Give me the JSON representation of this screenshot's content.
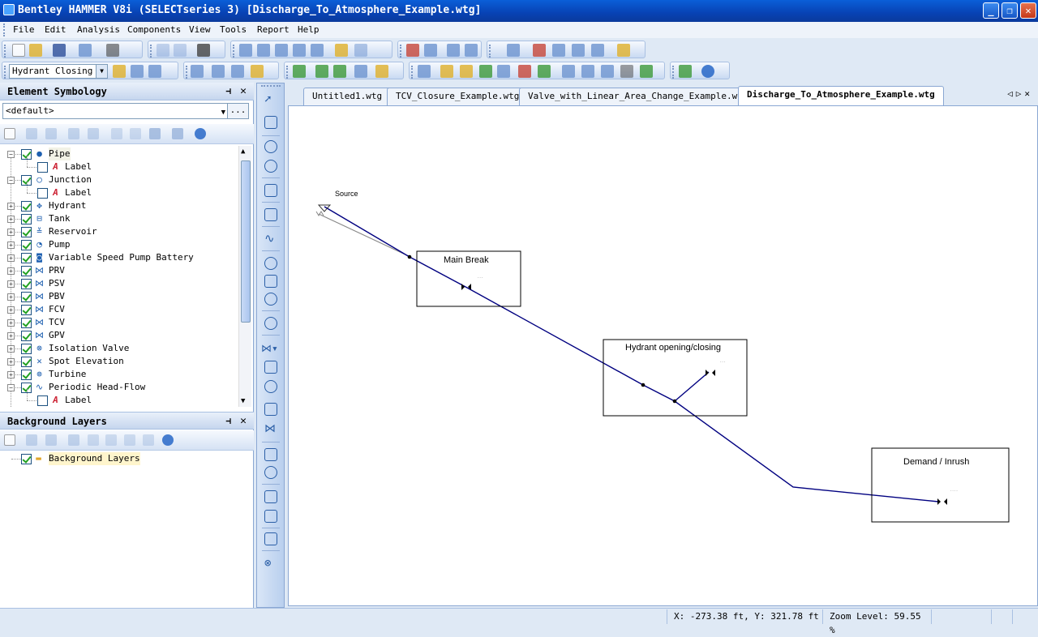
{
  "window": {
    "title": "Bentley HAMMER V8i (SELECTseries 3) [Discharge_To_Atmosphere_Example.wtg]"
  },
  "menu": [
    "File",
    "Edit",
    "Analysis",
    "Components",
    "View",
    "Tools",
    "Report",
    "Help"
  ],
  "toolbar": {
    "scenario_selected": "Hydrant Closing"
  },
  "element_symbology": {
    "title": "Element Symbology",
    "dropdown_value": "<default>",
    "ellipsis": "...",
    "items": [
      {
        "label": "Pipe",
        "checked": true,
        "icon": "pipe-icon",
        "glyph": "●",
        "expanded": true
      },
      {
        "label": "Label",
        "checked": false,
        "icon": "label-icon",
        "glyph": "A",
        "child": true
      },
      {
        "label": "Junction",
        "checked": true,
        "icon": "junction-icon",
        "glyph": "○",
        "expanded": true
      },
      {
        "label": "Label",
        "checked": false,
        "icon": "label-icon",
        "glyph": "A",
        "child": true
      },
      {
        "label": "Hydrant",
        "checked": true,
        "icon": "hydrant-icon",
        "glyph": "✥"
      },
      {
        "label": "Tank",
        "checked": true,
        "icon": "tank-icon",
        "glyph": "⊟"
      },
      {
        "label": "Reservoir",
        "checked": true,
        "icon": "reservoir-icon",
        "glyph": "≚"
      },
      {
        "label": "Pump",
        "checked": true,
        "icon": "pump-icon",
        "glyph": "◔"
      },
      {
        "label": "Variable Speed Pump Battery",
        "checked": true,
        "icon": "vspb-icon",
        "glyph": "◙"
      },
      {
        "label": "PRV",
        "checked": true,
        "icon": "prv-icon",
        "glyph": "⋈"
      },
      {
        "label": "PSV",
        "checked": true,
        "icon": "psv-icon",
        "glyph": "⋈"
      },
      {
        "label": "PBV",
        "checked": true,
        "icon": "pbv-icon",
        "glyph": "⋈"
      },
      {
        "label": "FCV",
        "checked": true,
        "icon": "fcv-icon",
        "glyph": "⋈"
      },
      {
        "label": "TCV",
        "checked": true,
        "icon": "tcv-icon",
        "glyph": "⋈"
      },
      {
        "label": "GPV",
        "checked": true,
        "icon": "gpv-icon",
        "glyph": "⋈"
      },
      {
        "label": "Isolation Valve",
        "checked": true,
        "icon": "isolation-valve-icon",
        "glyph": "⊗"
      },
      {
        "label": "Spot Elevation",
        "checked": true,
        "icon": "spot-elevation-icon",
        "glyph": "✕"
      },
      {
        "label": "Turbine",
        "checked": true,
        "icon": "turbine-icon",
        "glyph": "⊚"
      },
      {
        "label": "Periodic Head-Flow",
        "checked": true,
        "icon": "periodic-head-flow-icon",
        "glyph": "∿",
        "expanded": true
      },
      {
        "label": "Label",
        "checked": false,
        "icon": "label-icon",
        "glyph": "A",
        "child": true
      }
    ]
  },
  "background_layers": {
    "title": "Background Layers",
    "items": [
      {
        "label": "Background Layers",
        "checked": true
      }
    ]
  },
  "tabs": [
    {
      "label": "Untitled1.wtg",
      "active": false
    },
    {
      "label": "TCV_Closure_Example.wtg",
      "active": false
    },
    {
      "label": "Valve_with_Linear_Area_Change_Example.wtg",
      "active": false
    },
    {
      "label": "Discharge_To_Atmosphere_Example.wtg",
      "active": true
    }
  ],
  "drawing": {
    "source_label": "Source",
    "boxes": [
      {
        "label": "Main Break"
      },
      {
        "label": "Hydrant opening/closing"
      },
      {
        "label": "Demand / Inrush"
      }
    ]
  },
  "status": {
    "coords": "X: -273.38 ft, Y: 321.78 ft",
    "zoom": "Zoom Level: 59.55 %"
  },
  "colors": {
    "pipe": "#000080",
    "title_bar": "#0842b4",
    "check": "#21a121"
  }
}
